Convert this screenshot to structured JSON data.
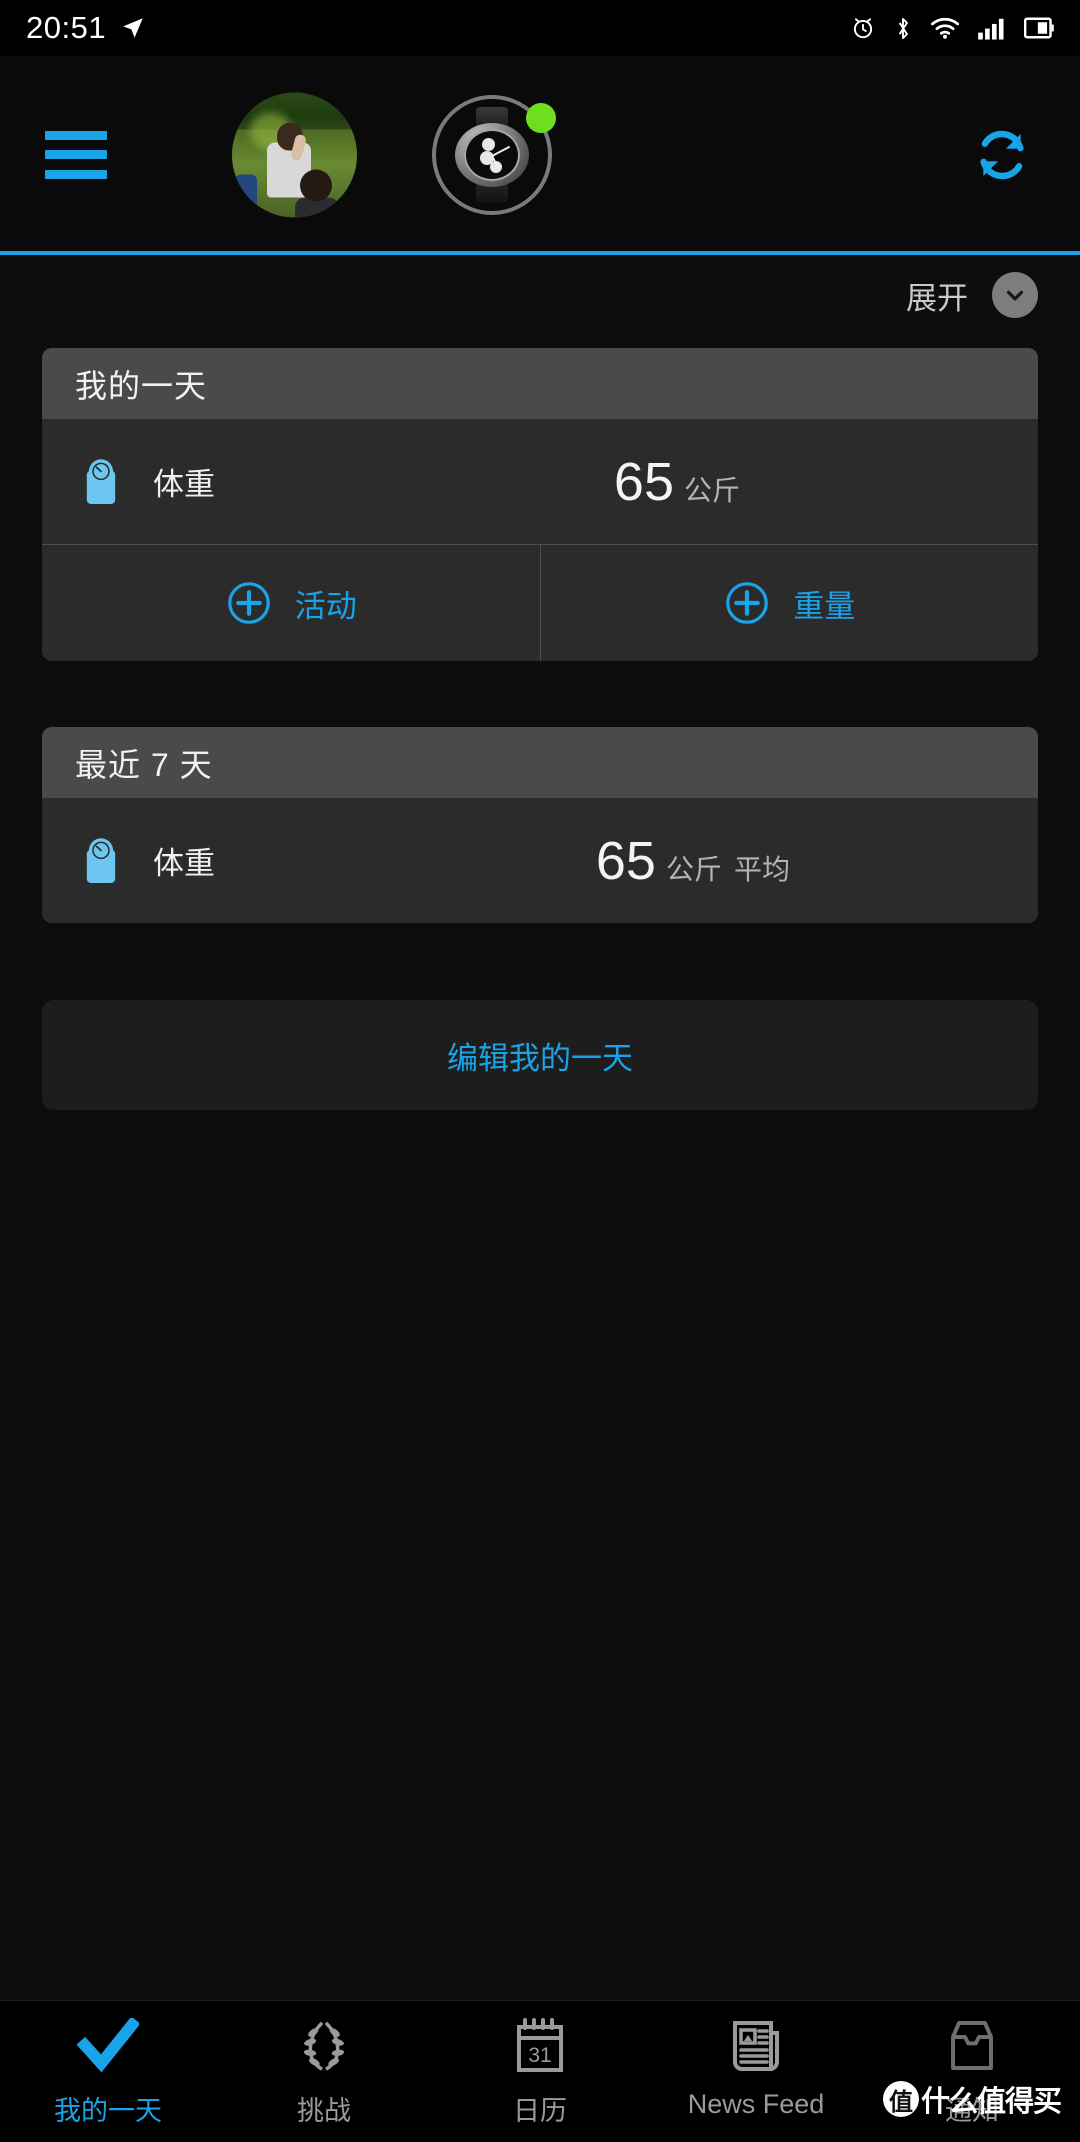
{
  "statusbar": {
    "time": "20:51",
    "icons": [
      "location-arrow-icon",
      "alarm-icon",
      "bluetooth-icon",
      "wifi-icon",
      "cellular-signal-icon",
      "battery-icon"
    ]
  },
  "header": {
    "menu_icon": "hamburger-menu-icon",
    "avatar_alt": "profile-photo",
    "device_icon": "smartwatch-icon",
    "device_status": "connected",
    "device_status_color": "#6ddf1e",
    "sync_icon": "sync-refresh-icon",
    "accent_color": "#19a3e8"
  },
  "expand": {
    "label": "展开",
    "chevron_icon": "chevron-down-icon"
  },
  "cards": [
    {
      "title": "我的一天",
      "metric": {
        "icon": "weight-scale-icon",
        "label": "体重",
        "value": "65",
        "unit": "公斤",
        "qualifier": ""
      },
      "actions": [
        {
          "icon": "plus-circle-icon",
          "label": "活动"
        },
        {
          "icon": "plus-circle-icon",
          "label": "重量"
        }
      ]
    },
    {
      "title": "最近 7 天",
      "metric": {
        "icon": "weight-scale-icon",
        "label": "体重",
        "value": "65",
        "unit": "公斤",
        "qualifier": "平均"
      },
      "actions": []
    }
  ],
  "edit_button": {
    "label": "编辑我的一天"
  },
  "bottomnav": {
    "items": [
      {
        "label": "我的一天",
        "icon": "checkmark-icon",
        "active": true
      },
      {
        "label": "挑战",
        "icon": "laurel-wreath-icon",
        "active": false
      },
      {
        "label": "日历",
        "icon": "calendar-31-icon",
        "active": false
      },
      {
        "label": "News Feed",
        "icon": "newspaper-icon",
        "active": false
      },
      {
        "label": "通知",
        "icon": "inbox-tray-icon",
        "active": false
      }
    ]
  },
  "watermark": {
    "badge": "值",
    "text": "什么值得买"
  }
}
